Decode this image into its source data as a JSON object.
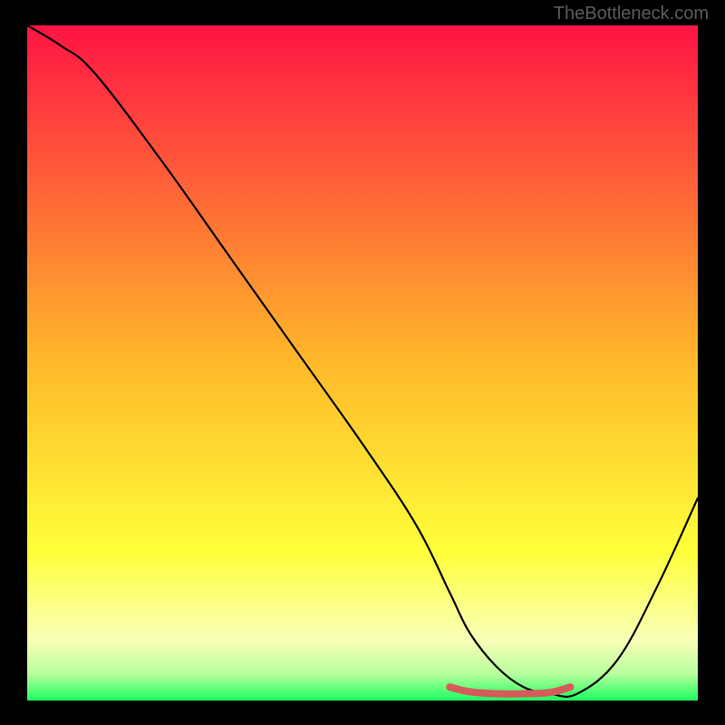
{
  "watermark": "TheBottleneck.com",
  "chart_data": {
    "type": "line",
    "title": "",
    "xlabel": "",
    "ylabel": "",
    "xlim": [
      0,
      100
    ],
    "ylim": [
      0,
      100
    ],
    "background_gradient": {
      "stops": [
        {
          "offset": 0,
          "color": "#ff1444"
        },
        {
          "offset": 50,
          "color": "#ffb92a"
        },
        {
          "offset": 78,
          "color": "#ffff3a"
        },
        {
          "offset": 91,
          "color": "#f9ffb7"
        },
        {
          "offset": 96,
          "color": "#b9ff9e"
        },
        {
          "offset": 100,
          "color": "#1eff5f"
        }
      ]
    },
    "series": [
      {
        "name": "bottleneck-curve",
        "color": "#000000",
        "x": [
          0,
          5,
          10,
          20,
          30,
          40,
          50,
          58,
          63,
          66,
          70,
          74,
          78,
          82,
          88,
          94,
          100
        ],
        "values": [
          100,
          97,
          93,
          80,
          66,
          52,
          38,
          26,
          16,
          10,
          5,
          2,
          1,
          1,
          6,
          17,
          30
        ]
      },
      {
        "name": "optimal-region",
        "color": "#d75a5a",
        "thick": true,
        "x": [
          63,
          66,
          70,
          74,
          78,
          81
        ],
        "values": [
          2,
          1.3,
          1,
          1,
          1.2,
          2
        ]
      }
    ]
  }
}
